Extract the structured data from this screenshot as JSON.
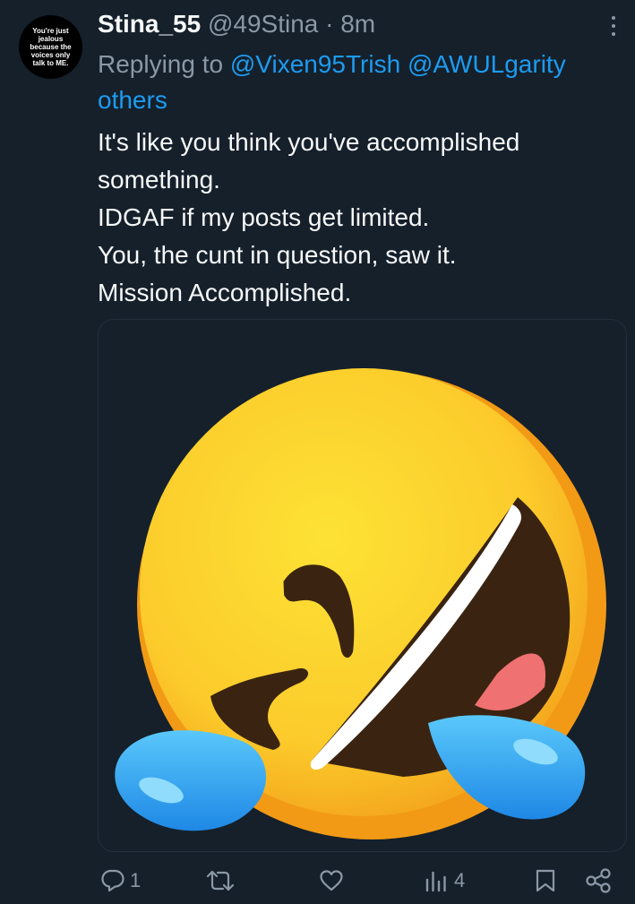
{
  "tweet": {
    "avatar_text": "You're just jealous because the voices only talk to ME.",
    "display_name": "Stina_55",
    "handle": "@49Stina",
    "separator": "·",
    "time": "8m",
    "replying_prefix": "Replying to",
    "mentions": [
      "@Vixen95Trish",
      "@AWULgarity"
    ],
    "others_label": "others",
    "body_lines": [
      "It's like you think you've accomplished",
      "something.",
      "IDGAF if my posts get limited.",
      "You, the cunt in question, saw it.",
      "Mission Accomplished."
    ],
    "media_icon": "rolling-on-the-floor-laughing-emoji"
  },
  "actions": {
    "reply_count": "1",
    "retweet_count": "",
    "like_count": "",
    "views_count": "4"
  },
  "colors": {
    "background": "#15202b",
    "text": "#f7f9f9",
    "muted": "#8b98a5",
    "link": "#1d9bf0"
  }
}
